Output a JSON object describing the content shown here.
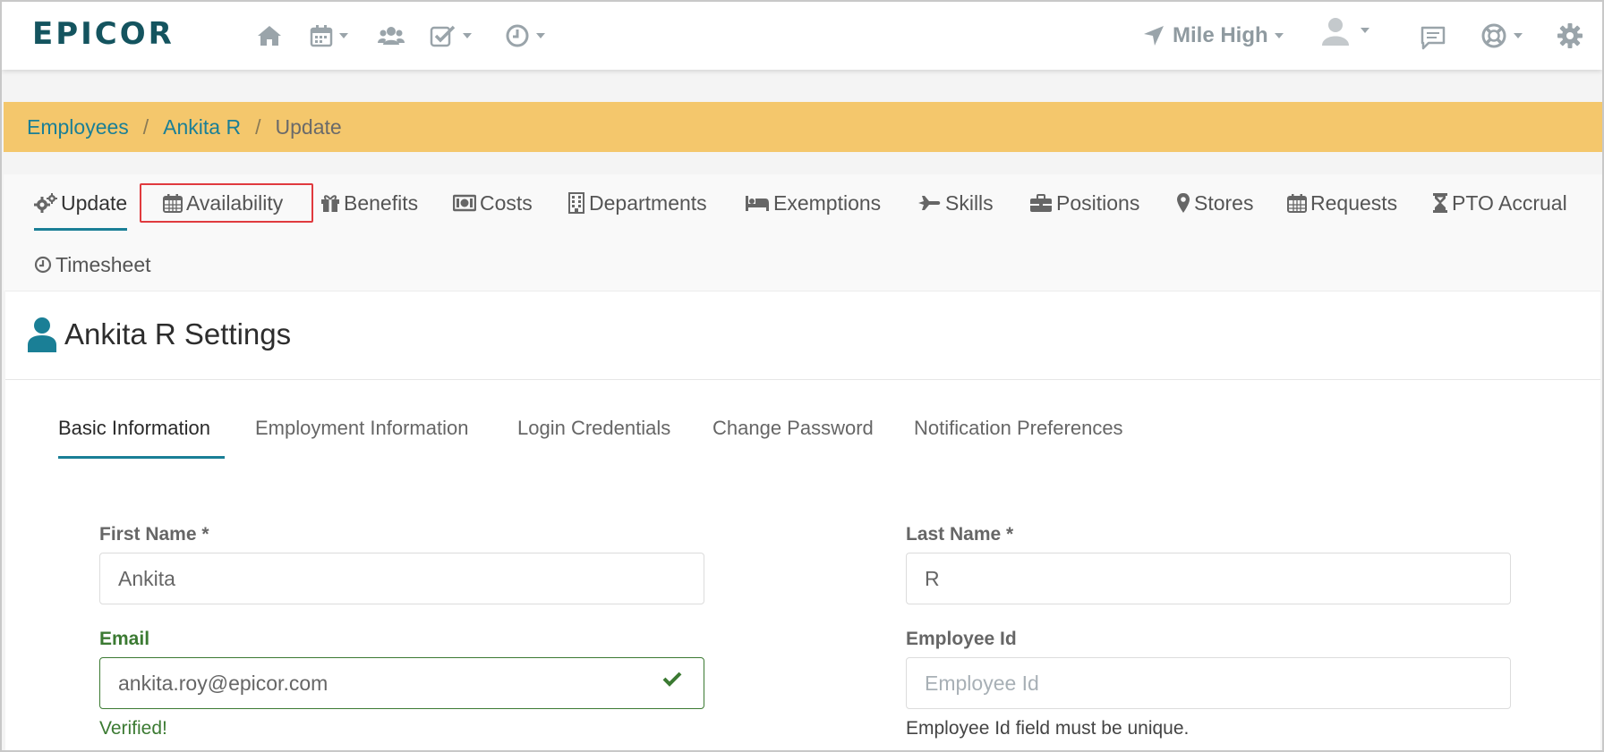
{
  "navbar": {
    "logo_text": "EPICOR",
    "icons": [
      "home-icon",
      "calendar-icon",
      "users-icon",
      "check-square-icon",
      "clock-icon",
      "location-arrow-icon",
      "user-avatar-icon",
      "chat-icon",
      "help-lifering-icon",
      "gear-icon"
    ],
    "location_label": "Mile High"
  },
  "breadcrumb": {
    "items": [
      "Employees",
      "Ankita R"
    ],
    "separator": "/",
    "current": "Update"
  },
  "subnav": {
    "tabs": [
      {
        "label": "Update",
        "icon": "cogs-icon",
        "active": true
      },
      {
        "label": "Availability",
        "icon": "calendar-icon"
      },
      {
        "label": "Benefits",
        "icon": "gift-icon"
      },
      {
        "label": "Costs",
        "icon": "money-icon"
      },
      {
        "label": "Departments",
        "icon": "building-icon"
      },
      {
        "label": "Exemptions",
        "icon": "bed-icon"
      },
      {
        "label": "Skills",
        "icon": "plane-icon"
      },
      {
        "label": "Positions",
        "icon": "briefcase-icon"
      },
      {
        "label": "Stores",
        "icon": "map-marker-icon"
      },
      {
        "label": "Requests",
        "icon": "calendar-icon"
      },
      {
        "label": "PTO Accrual",
        "icon": "hourglass-icon"
      },
      {
        "label": "Timesheet",
        "icon": "clock-icon"
      }
    ]
  },
  "page": {
    "title": "Ankita R Settings",
    "title_icon": "user-icon"
  },
  "inner_tabs": [
    "Basic Information",
    "Employment Information",
    "Login Credentials",
    "Change Password",
    "Notification Preferences"
  ],
  "form": {
    "first_name": {
      "label": "First Name *",
      "value": "Ankita"
    },
    "last_name": {
      "label": "Last Name *",
      "value": "R"
    },
    "email": {
      "label": "Email",
      "value": "ankita.roy@epicor.com",
      "status": "Verified!"
    },
    "employee_id": {
      "label": "Employee Id",
      "value": "",
      "placeholder": "Employee Id",
      "help": "Employee Id field must be unique."
    }
  },
  "colors": {
    "brand": "#14545f",
    "accent": "#1a7f96",
    "breadcrumb_bg": "#f4c76c",
    "success": "#3b7a32",
    "highlight": "#e03a3e"
  }
}
